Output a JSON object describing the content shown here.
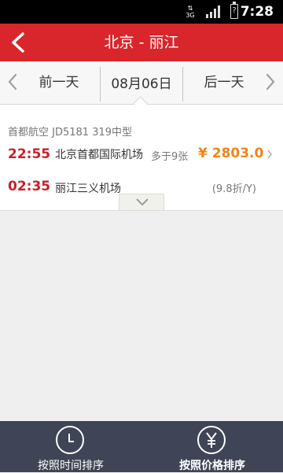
{
  "status_bar": {
    "network": "3G",
    "time": "7:28"
  },
  "header": {
    "title": "北京 - 丽江"
  },
  "date_bar": {
    "prev_label": "前一天",
    "current_date": "08月06日",
    "next_label": "后一天"
  },
  "flight": {
    "airline_info": "首都航空  JD5181  319中型",
    "departure_time": "22:55",
    "departure_airport": "北京首都国际机场",
    "seats": "多于9张",
    "price": "¥ 2803.0",
    "arrival_time": "02:35",
    "arrival_airport": "丽江三义机场",
    "discount": "(9.8折/Y)"
  },
  "bottom_bar": {
    "sort_time_label": "按照时间排序",
    "sort_price_label": "按照价格排序"
  },
  "colors": {
    "brand_red": "#d8262c",
    "price_orange": "#f08519",
    "bottom_bar": "#3f4556"
  }
}
